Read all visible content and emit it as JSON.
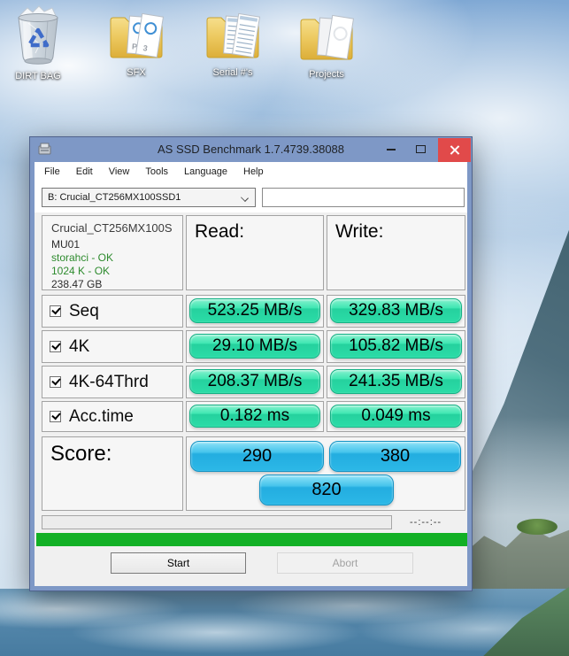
{
  "desktop": {
    "icons": [
      {
        "label": "DIRT BAG",
        "kind": "recycle-bin-full"
      },
      {
        "label": "SFX",
        "kind": "folder-audio-files"
      },
      {
        "label": "Serial #'s",
        "kind": "folder-documents"
      },
      {
        "label": "Projects",
        "kind": "folder-document"
      }
    ]
  },
  "window": {
    "title": "AS SSD Benchmark 1.7.4739.38088",
    "menu": [
      {
        "label": "File"
      },
      {
        "label": "Edit"
      },
      {
        "label": "View"
      },
      {
        "label": "Tools"
      },
      {
        "label": "Language"
      },
      {
        "label": "Help"
      }
    ],
    "drive_select": {
      "value": "B: Crucial_CT256MX100SSD1"
    },
    "result_box_value": "",
    "info": {
      "model": "Crucial_CT256MX100S",
      "firmware": "MU01",
      "driver": "storahci - OK",
      "alignment": "1024 K - OK",
      "capacity": "238.47 GB"
    },
    "columns": {
      "read": "Read:",
      "write": "Write:"
    },
    "tests": [
      {
        "label": "Seq",
        "checked": true,
        "read": "523.25 MB/s",
        "write": "329.83 MB/s"
      },
      {
        "label": "4K",
        "checked": true,
        "read": "29.10 MB/s",
        "write": "105.82 MB/s"
      },
      {
        "label": "4K-64Thrd",
        "checked": true,
        "read": "208.37 MB/s",
        "write": "241.35 MB/s"
      },
      {
        "label": "Acc.time",
        "checked": true,
        "read": "0.182 ms",
        "write": "0.049 ms"
      }
    ],
    "score": {
      "label": "Score:",
      "read": "290",
      "write": "380",
      "total": "820"
    },
    "progress": {
      "time_remaining": "--:--:--"
    },
    "buttons": {
      "start": "Start",
      "abort": "Abort"
    }
  },
  "colors": {
    "titlebar": "#7e98c6",
    "close_button": "#e14a4a",
    "result_pill_green": "#2ad5a0",
    "score_pill_blue": "#29b6e6",
    "status_bar_green": "#12b025",
    "driver_ok_text": "#2e8b2e"
  }
}
